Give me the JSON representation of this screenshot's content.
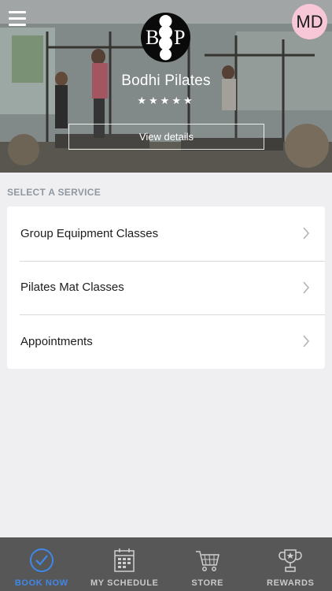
{
  "studio": {
    "name": "Bodhi Pilates",
    "rating_stars": "★★★★★",
    "rating_value": 5,
    "details_label": "View details",
    "logo_letters": {
      "left": "B",
      "right": "P"
    }
  },
  "user": {
    "initials": "MD"
  },
  "services": {
    "section_label": "SELECT A SERVICE",
    "items": [
      {
        "label": "Group Equipment Classes"
      },
      {
        "label": "Pilates Mat Classes"
      },
      {
        "label": "Appointments"
      }
    ]
  },
  "tabbar": {
    "tabs": [
      {
        "label": "BOOK NOW",
        "icon": "check-circle-icon",
        "active": true
      },
      {
        "label": "MY SCHEDULE",
        "icon": "calendar-icon",
        "active": false
      },
      {
        "label": "STORE",
        "icon": "cart-icon",
        "active": false
      },
      {
        "label": "REWARDS",
        "icon": "trophy-icon",
        "active": false
      }
    ]
  },
  "colors": {
    "accent": "#3f88e8",
    "tabbar_bg": "#575757",
    "avatar_bg": "#f7c6d7",
    "page_bg": "#efeff1"
  }
}
